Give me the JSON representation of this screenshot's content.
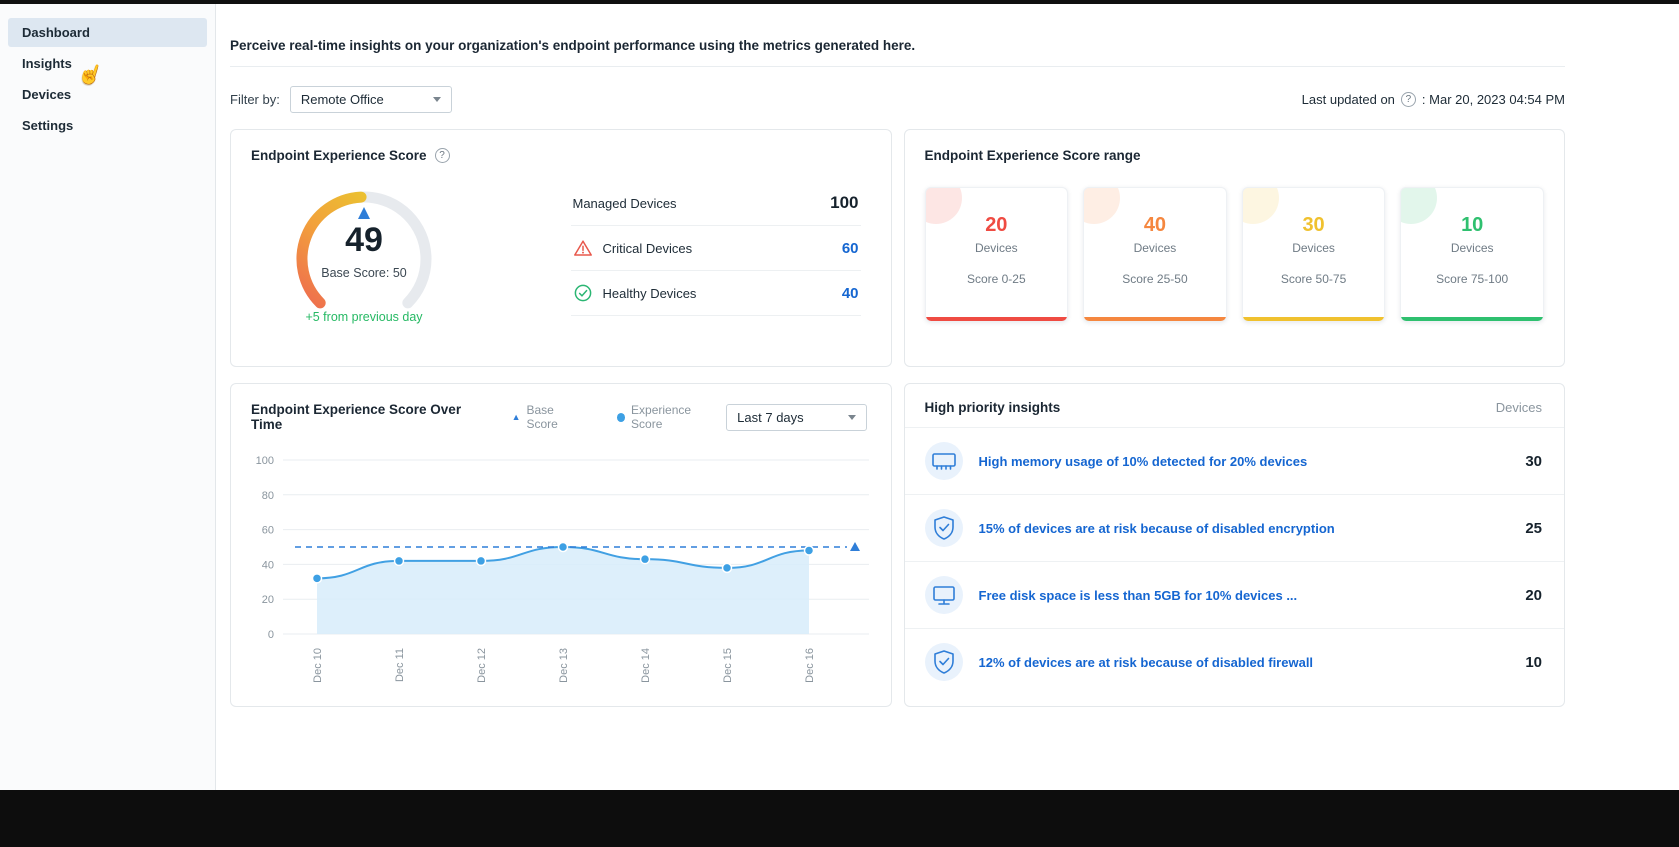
{
  "colors": {
    "accent_blue": "#1566d1",
    "chart_blue": "#41a0e3",
    "base_line_blue": "#2f7ed8",
    "positive_green": "#26b964",
    "range_red": "#ef4b42",
    "range_orange": "#f5873f",
    "range_yellow": "#f0c12e",
    "range_green": "#2fc06f"
  },
  "sidebar": {
    "items": [
      {
        "label": "Dashboard",
        "active": true
      },
      {
        "label": "Insights",
        "active": false
      },
      {
        "label": "Devices",
        "active": false
      },
      {
        "label": "Settings",
        "active": false
      }
    ]
  },
  "header": {
    "description": "Perceive real-time insights on your organization's endpoint performance using the metrics generated here."
  },
  "filter": {
    "label": "Filter by:",
    "selected": "Remote Office",
    "help_icon": "?",
    "last_updated_label": "Last updated on",
    "last_updated_value": ": Mar 20, 2023 04:54 PM"
  },
  "score_card": {
    "title": "Endpoint Experience Score",
    "help_icon": "?",
    "score": 49,
    "base_score_label": "Base Score: 50",
    "delta_text": "+5 from previous day",
    "stats": [
      {
        "label": "Managed Devices",
        "value": 100
      },
      {
        "label": "Critical Devices",
        "value": 60
      },
      {
        "label": "Healthy Devices",
        "value": 40
      }
    ]
  },
  "range_card": {
    "title": "Endpoint Experience Score range",
    "ranges": [
      {
        "count": 20,
        "label": "Devices",
        "range": "Score 0-25",
        "color": "#ef4b42"
      },
      {
        "count": 40,
        "label": "Devices",
        "range": "Score 25-50",
        "color": "#f5873f"
      },
      {
        "count": 30,
        "label": "Devices",
        "range": "Score 50-75",
        "color": "#f0c12e"
      },
      {
        "count": 10,
        "label": "Devices",
        "range": "Score 75-100",
        "color": "#2fc06f"
      }
    ]
  },
  "trend_card": {
    "title": "Endpoint Experience Score Over Time",
    "legend": [
      {
        "label": "Base Score",
        "marker": "triangle"
      },
      {
        "label": "Experience Score",
        "marker": "dot"
      }
    ],
    "period": "Last 7 days"
  },
  "chart_data": {
    "type": "line",
    "title": "Endpoint Experience Score Over Time",
    "x": [
      "Dec 10",
      "Dec 11",
      "Dec 12",
      "Dec 13",
      "Dec 14",
      "Dec 15",
      "Dec 16"
    ],
    "series": [
      {
        "name": "Experience Score",
        "values": [
          32,
          42,
          42,
          50,
          43,
          38,
          48
        ]
      },
      {
        "name": "Base Score",
        "values": [
          50,
          50,
          50,
          50,
          50,
          50,
          50
        ]
      }
    ],
    "ylim": [
      0,
      100
    ],
    "yticks": [
      0,
      20,
      40,
      60,
      80,
      100
    ],
    "grid": true,
    "legend_position": "top"
  },
  "insights_card": {
    "title": "High priority insights",
    "devices_header": "Devices",
    "rows": [
      {
        "icon": "memory-icon",
        "text": "High memory usage of 10% detected for 20% devices",
        "count": 30
      },
      {
        "icon": "shield-check-icon",
        "text": "15% of devices are at risk because of disabled encryption",
        "count": 25
      },
      {
        "icon": "monitor-icon",
        "text": "Free disk space is less than 5GB for 10% devices ...",
        "count": 20
      },
      {
        "icon": "shield-check-icon",
        "text": "12% of devices are at risk because of disabled firewall",
        "count": 10
      }
    ]
  }
}
